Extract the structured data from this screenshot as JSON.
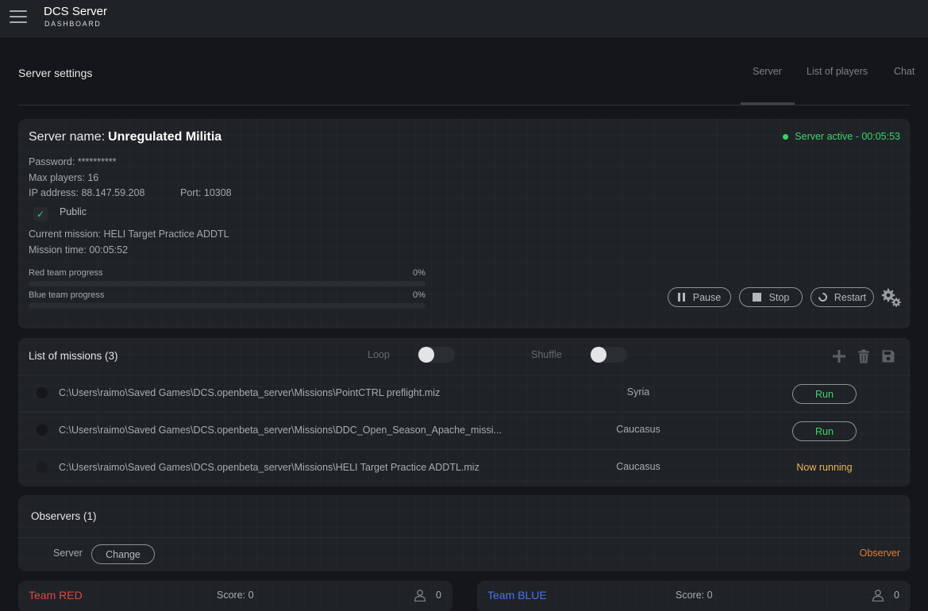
{
  "app": {
    "title": "DCS Server",
    "subtitle": "DASHBOARD"
  },
  "header": {
    "title": "Server settings",
    "tabs": [
      {
        "label": "Server",
        "active": true
      },
      {
        "label": "List of players",
        "active": false
      },
      {
        "label": "Chat",
        "active": false
      }
    ]
  },
  "server": {
    "name_label": "Server name:",
    "name": "Unregulated Militia",
    "status": "Server active - 00:05:53",
    "status_color": "#3ed46f",
    "password": "Password: **********",
    "max_players": "Max players: 16",
    "ip": "IP address: 88.147.59.208",
    "port": "Port: 10308",
    "public_label": "Public",
    "public_checked": true,
    "current_mission": "Current mission: HELI Target Practice ADDTL",
    "mission_time": "Mission time: 00:05:52",
    "red_progress": {
      "label": "Red team progress",
      "value_text": "0%",
      "value": 0
    },
    "blue_progress": {
      "label": "Blue team progress",
      "value_text": "0%",
      "value": 0
    },
    "buttons": {
      "pause": "Pause",
      "stop": "Stop",
      "restart": "Restart"
    }
  },
  "missions": {
    "title": "List of missions (3)",
    "loop_label": "Loop",
    "shuffle_label": "Shuffle",
    "loop_on": false,
    "shuffle_on": false,
    "rows": [
      {
        "path": "C:\\Users\\raimo\\Saved Games\\DCS.openbeta_server\\Missions\\PointCTRL preflight.miz",
        "map": "Syria",
        "action": "Run"
      },
      {
        "path": "C:\\Users\\raimo\\Saved Games\\DCS.openbeta_server\\Missions\\DDC_Open_Season_Apache_missi...",
        "map": "Caucasus",
        "action": "Run"
      },
      {
        "path": "C:\\Users\\raimo\\Saved Games\\DCS.openbeta_server\\Missions\\HELI Target Practice ADDTL.miz",
        "map": "Caucasus",
        "action": "Now running"
      }
    ]
  },
  "observers": {
    "title": "Observers (1)",
    "rows": [
      {
        "name": "Server",
        "button": "Change",
        "role": "Observer"
      }
    ]
  },
  "teams": {
    "red": {
      "name": "Team RED",
      "score": "Score: 0",
      "count": "0",
      "color": "#e04646"
    },
    "blue": {
      "name": "Team BLUE",
      "score": "Score: 0",
      "count": "0",
      "color": "#4a74f0"
    }
  },
  "icons": {
    "menu": "hamburger-icon",
    "check": "checkmark-icon",
    "pause": "pause-icon",
    "stop": "stop-icon",
    "restart": "restart-icon",
    "settings": "gears-icon",
    "add": "plus-icon",
    "delete": "trash-icon",
    "save": "floppy-disk-icon",
    "user": "user-icon"
  }
}
